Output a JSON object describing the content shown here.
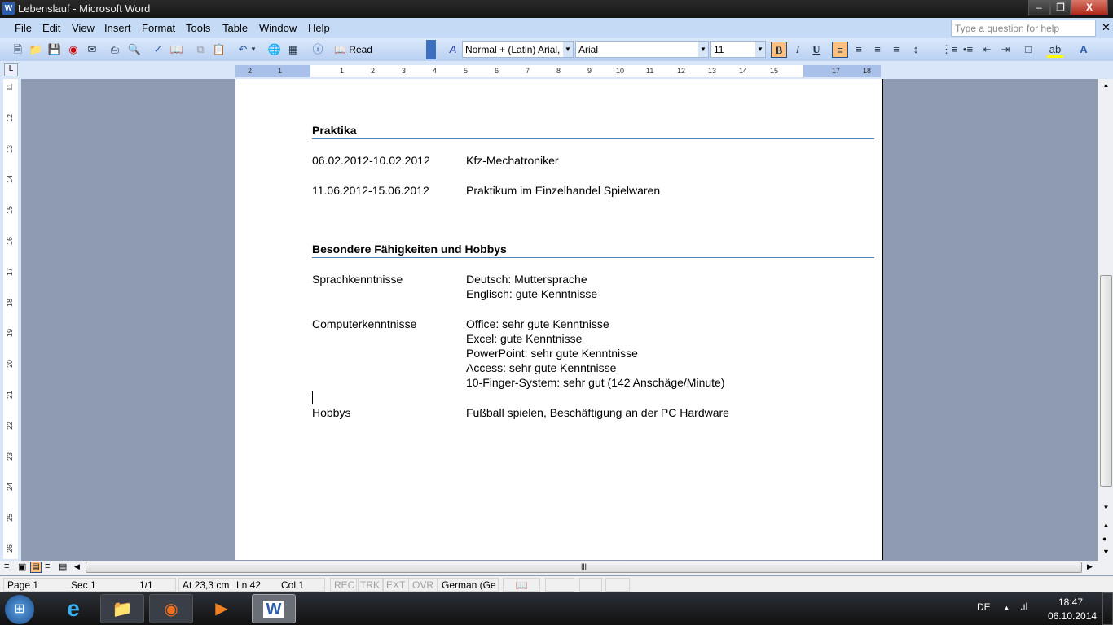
{
  "window": {
    "title": "Lebenslauf - Microsoft Word"
  },
  "menu": [
    "File",
    "Edit",
    "View",
    "Insert",
    "Format",
    "Tools",
    "Table",
    "Window",
    "Help"
  ],
  "help_placeholder": "Type a question for help",
  "toolbar": {
    "read_label": "Read",
    "style": "Normal + (Latin) Arial,",
    "font": "Arial",
    "size": "11"
  },
  "ruler": {
    "h_ticks": [
      "2",
      "1",
      "1",
      "2",
      "3",
      "4",
      "5",
      "6",
      "7",
      "8",
      "9",
      "10",
      "11",
      "12",
      "13",
      "14",
      "15",
      "17",
      "18"
    ],
    "v_ticks": [
      "11",
      "12",
      "13",
      "14",
      "15",
      "16",
      "17",
      "18",
      "19",
      "20",
      "21",
      "22",
      "23",
      "24",
      "25",
      "26"
    ]
  },
  "document": {
    "sections": [
      {
        "heading": "Praktika",
        "rows": [
          {
            "left": "06.02.2012-10.02.2012",
            "right": [
              "Kfz-Mechatroniker"
            ]
          },
          {
            "left": "11.06.2012-15.06.2012",
            "right": [
              "Praktikum im Einzelhandel Spielwaren"
            ]
          }
        ]
      },
      {
        "heading": "Besondere Fähigkeiten und Hobbys",
        "rows": [
          {
            "left": "Sprachkenntnisse",
            "right": [
              "Deutsch: Muttersprache",
              "Englisch: gute Kenntnisse"
            ]
          },
          {
            "left": "Computerkenntnisse",
            "right": [
              "Office: sehr gute Kenntnisse",
              "Excel: gute Kenntnisse",
              "PowerPoint: sehr gute Kenntnisse",
              "Access: sehr gute Kenntnisse",
              "10-Finger-System: sehr gut (142 Anschäge/Minute)"
            ]
          },
          {
            "left": "Hobbys",
            "right": [
              "Fußball spielen, Beschäftigung an der PC Hardware"
            ]
          }
        ]
      }
    ]
  },
  "status": {
    "page": "Page 1",
    "sec": "Sec 1",
    "pages": "1/1",
    "at": "At 23,3 cm",
    "ln": "Ln 42",
    "col": "Col 1",
    "rec": "REC",
    "trk": "TRK",
    "ext": "EXT",
    "ovr": "OVR",
    "lang": "German (Ge"
  },
  "tray": {
    "lang": "DE",
    "time": "18:47",
    "date": "06.10.2014"
  },
  "colors": {
    "heading_rule": "#4f81bd",
    "workspace": "#8f9bb0",
    "toolbar": "#c5daf5"
  }
}
